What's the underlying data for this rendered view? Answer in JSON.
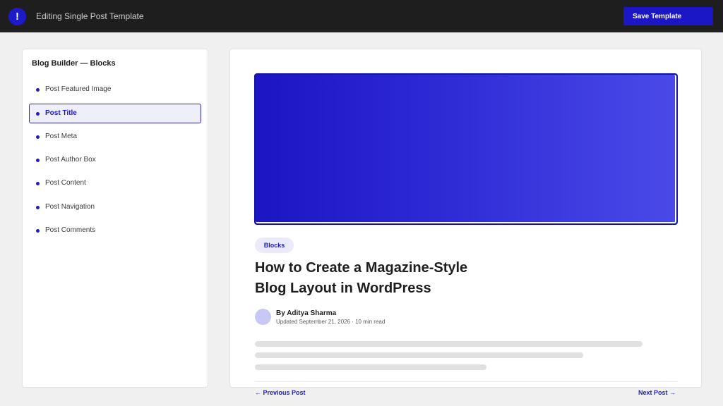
{
  "header": {
    "logo_glyph": "!",
    "title": "Editing Single Post Template",
    "save_label": "Save Template"
  },
  "sidebar": {
    "heading": "Blog Builder — Blocks",
    "items": [
      {
        "label": "Post Featured Image",
        "active": false
      },
      {
        "label": "Post Title",
        "active": true
      },
      {
        "label": "Post Meta",
        "active": false
      },
      {
        "label": "Post Author Box",
        "active": false
      },
      {
        "label": "Post Content",
        "active": false
      },
      {
        "label": "Post Navigation",
        "active": false
      },
      {
        "label": "Post Comments",
        "active": false
      }
    ]
  },
  "post": {
    "category": "Blocks",
    "title_line1": "How to Create a Magazine-Style",
    "title_line2": "Blog Layout in WordPress",
    "author": "By Aditya Sharma",
    "meta": "Updated September 21, 2026 · 10 min read",
    "prev_label": "← Previous Post",
    "next_label": "Next Post →"
  },
  "colors": {
    "accent": "#1c1ac9",
    "topbar": "#1e1e1e",
    "active_bg": "#efeefb"
  }
}
